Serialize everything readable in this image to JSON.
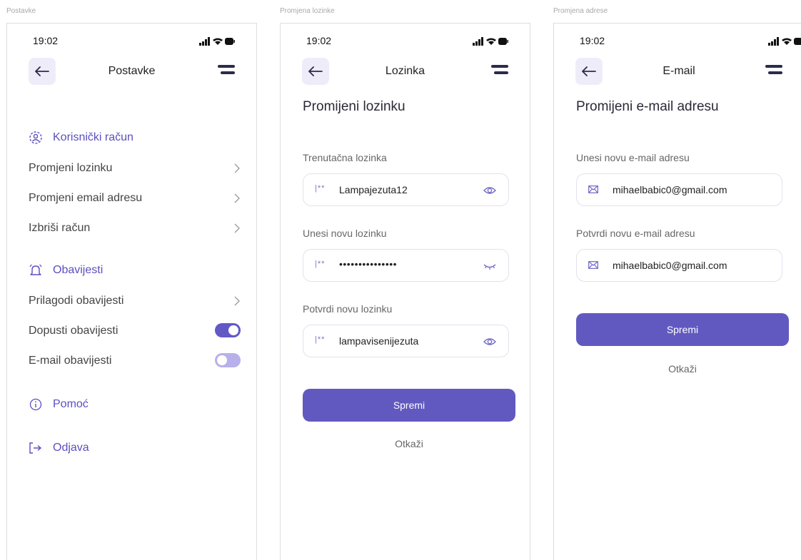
{
  "frames": [
    {
      "label": "Postavke"
    },
    {
      "label": "Promjena lozinke"
    },
    {
      "label": "Promjena adrese"
    }
  ],
  "status_bar": {
    "time": "19:02"
  },
  "settings": {
    "title": "Postavke",
    "account_section": "Korisnički račun",
    "account_items": [
      "Promjeni lozinku",
      "Promjeni email adresu",
      "Izbriši račun"
    ],
    "notifications_section": "Obavijesti",
    "customize_notifications": "Prilagodi obavijesti",
    "allow_notifications": {
      "label": "Dopusti obavijesti",
      "enabled": true
    },
    "email_notifications": {
      "label": "E-mail obavijesti",
      "enabled": false
    },
    "help": "Pomoć",
    "logout": "Odjava"
  },
  "password": {
    "title": "Lozinka",
    "heading": "Promijeni lozinku",
    "current_label": "Trenutačna lozinka",
    "current_value": "Lampajezuta12",
    "new_label": "Unesi novu lozinku",
    "new_value": "•••••••••••••••",
    "confirm_label": "Potvrdi novu lozinku",
    "confirm_value": "lampavisenijezuta",
    "field_prefix": "|**",
    "save": "Spremi",
    "cancel": "Otkaži"
  },
  "email": {
    "title": "E-mail",
    "heading": "Promijeni e-mail adresu",
    "new_label": "Unesi novu e-mail adresu",
    "new_value": "mihaelbabic0@gmail.com",
    "confirm_label": "Potvrdi novu e-mail adresu",
    "confirm_value": "mihaelbabic0@gmail.com",
    "save": "Spremi",
    "cancel": "Otkaži"
  },
  "colors": {
    "accent": "#6259c0",
    "accent_light": "#efecfa",
    "toggle_off": "#b7b0ea",
    "text_dark": "#222222"
  }
}
